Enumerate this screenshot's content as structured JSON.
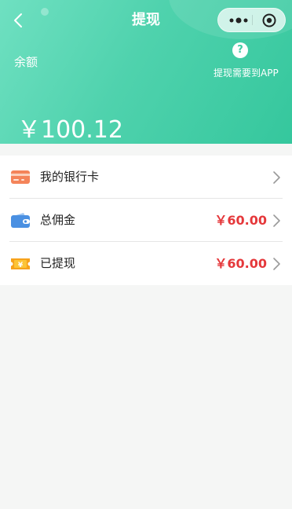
{
  "nav": {
    "title": "提现"
  },
  "balance": {
    "label": "余额",
    "amount": "￥100.12",
    "help_icon_text": "?",
    "help_text": "提现需要到APP"
  },
  "list": [
    {
      "label": "我的银行卡",
      "value": "",
      "icon": "bank-card-icon"
    },
    {
      "label": "总佣金",
      "value": "￥60.00",
      "icon": "wallet-icon"
    },
    {
      "label": "已提现",
      "value": "￥60.00",
      "icon": "yen-ticket-icon"
    }
  ],
  "colors": {
    "header_start": "#6fe0c1",
    "header_end": "#35c79d",
    "amount_red": "#e5383b",
    "page_bg": "#f5f6f5"
  }
}
